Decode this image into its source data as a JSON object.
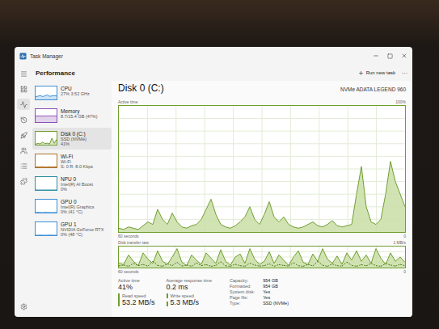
{
  "window": {
    "title": "Task Manager"
  },
  "nav": [
    {
      "selected": false
    },
    {
      "selected": false
    },
    {
      "selected": true
    },
    {
      "selected": false
    },
    {
      "selected": false
    },
    {
      "selected": false
    },
    {
      "selected": false
    },
    {
      "selected": false
    },
    {
      "selected": false
    }
  ],
  "header": {
    "title": "Performance",
    "run_task": "Run new task",
    "more": "···"
  },
  "sidebar": {
    "items": [
      {
        "name": "CPU",
        "lines": [
          "27% 3.52 GHz"
        ],
        "selected": false,
        "color": "#3c8fd6",
        "graph": [
          20,
          25,
          30,
          22,
          28,
          35,
          24,
          27,
          30,
          27
        ]
      },
      {
        "name": "Memory",
        "lines": [
          "8.7/15.4 GB (47%)"
        ],
        "selected": false,
        "color": "#8b4fb5",
        "graph": [
          46,
          47,
          47,
          46,
          47,
          47,
          48,
          47,
          47,
          47
        ]
      },
      {
        "name": "Disk 0 (C:)",
        "lines": [
          "SSD (NVMe)",
          "41%"
        ],
        "selected": true,
        "color": "#6f9e2f",
        "graph": [
          4,
          10,
          6,
          20,
          8,
          12,
          5,
          50,
          10,
          41
        ]
      },
      {
        "name": "Wi-Fi",
        "lines": [
          "Wi-Fi",
          "S: 0 R: 8.0 Kbps"
        ],
        "selected": false,
        "color": "#b0722a",
        "graph": [
          2,
          4,
          3,
          6,
          2,
          3,
          5,
          2,
          4,
          3
        ]
      },
      {
        "name": "NPU 0",
        "lines": [
          "Intel(R) AI Boost",
          "0%"
        ],
        "selected": false,
        "color": "#2f8fa0",
        "graph": [
          0,
          0,
          0,
          0,
          0,
          0,
          0,
          0,
          0,
          0
        ]
      },
      {
        "name": "GPU 0",
        "lines": [
          "Intel(R) Graphics",
          "0% (41 °C)"
        ],
        "selected": false,
        "color": "#3c8fd6",
        "graph": [
          1,
          2,
          1,
          0,
          2,
          1,
          1,
          0,
          1,
          0
        ]
      },
      {
        "name": "GPU 1",
        "lines": [
          "NVIDIA GeForce RTX",
          "0% (48 °C)"
        ],
        "selected": false,
        "color": "#3c8fd6",
        "graph": [
          0,
          0,
          1,
          0,
          0,
          0,
          1,
          0,
          0,
          0
        ]
      }
    ]
  },
  "panel": {
    "title": "Disk 0 (C:)",
    "model": "NVMe ADATA LEGEND 960"
  },
  "active_chart": {
    "label": "Active time",
    "max": "100%",
    "span": "60 seconds",
    "min": "0",
    "scale": 100,
    "values": [
      3,
      2,
      4,
      3,
      2,
      5,
      8,
      6,
      18,
      10,
      6,
      15,
      8,
      4,
      3,
      5,
      6,
      10,
      18,
      26,
      14,
      6,
      4,
      3,
      5,
      8,
      12,
      20,
      10,
      6,
      14,
      24,
      12,
      8,
      12,
      6,
      4,
      3,
      4,
      6,
      8,
      5,
      4,
      6,
      9,
      5,
      4,
      5,
      6,
      30,
      52,
      20,
      8,
      6,
      10,
      30,
      56,
      40,
      30,
      20
    ]
  },
  "transfer_chart": {
    "label": "Disk transfer rate",
    "max": "1 MB/s",
    "span": "60 seconds",
    "min": "0",
    "scale": 1000,
    "series": [
      {
        "name": "Read speed",
        "kind": "area",
        "color": "#6f9e2f",
        "values": [
          200,
          150,
          600,
          300,
          100,
          700,
          400,
          200,
          800,
          300,
          150,
          500,
          900,
          250,
          100,
          600,
          350,
          150,
          700,
          450,
          200,
          850,
          300,
          120,
          500,
          650,
          200,
          900,
          400,
          150,
          300,
          750,
          200,
          600,
          350,
          100,
          500,
          800,
          250,
          150,
          650,
          300,
          900,
          400,
          200,
          550,
          150,
          700,
          350,
          800,
          300,
          600,
          200,
          900,
          450,
          150,
          700,
          300,
          500,
          250
        ]
      },
      {
        "name": "Write speed",
        "kind": "line",
        "color": "#4f7a1c",
        "values": [
          80,
          120,
          60,
          200,
          90,
          150,
          70,
          300,
          100,
          60,
          180,
          90,
          250,
          70,
          120,
          60,
          220,
          90,
          140,
          60,
          100,
          280,
          80,
          60,
          160,
          90,
          60,
          210,
          120,
          70,
          90,
          180,
          60,
          140,
          100,
          70,
          230,
          90,
          60,
          150,
          80,
          300,
          110,
          60,
          170,
          90,
          70,
          260,
          100,
          60,
          140,
          80,
          200,
          90,
          60,
          190,
          120,
          70,
          150,
          90
        ]
      }
    ]
  },
  "stats": [
    {
      "label": "Active time",
      "value": "41%",
      "kind": "plain"
    },
    {
      "label": "Average response time",
      "value": "0.2 ms",
      "kind": "plain"
    },
    {
      "label": "Read speed",
      "value": "53.2 MB/s",
      "kind": "read"
    },
    {
      "label": "Write speed",
      "value": "5.3 MB/s",
      "kind": "write"
    }
  ],
  "properties": [
    {
      "label": "Capacity:",
      "value": "954 GB"
    },
    {
      "label": "Formatted:",
      "value": "954 GB"
    },
    {
      "label": "System disk:",
      "value": "Yes"
    },
    {
      "label": "Page file:",
      "value": "Yes"
    },
    {
      "label": "Type:",
      "value": "SSD (NVMe)"
    }
  ]
}
